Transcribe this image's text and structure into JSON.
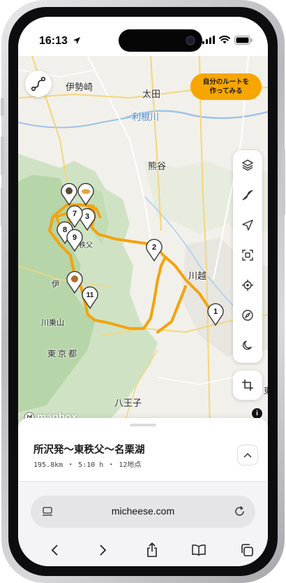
{
  "status": {
    "time": "16:13"
  },
  "map": {
    "labels": {
      "isesaki": "伊勢崎",
      "ota": "太田",
      "tonegawa": "利根川",
      "kumagaya": "熊谷",
      "kawagoe": "川越",
      "tokyo": "東京都",
      "hachioji": "八王子",
      "kawanoriyama": "川乗山",
      "chichibu_frag": "秩父",
      "ze": "伊",
      "edge_e": "東"
    },
    "cta": {
      "line1": "自分のルートを",
      "line2": "作ってみる"
    },
    "attribution": "mapbox",
    "info": "i",
    "pins": [
      "1",
      "2",
      "3",
      "7",
      "8",
      "9",
      "11"
    ]
  },
  "controls": [
    "layers-icon",
    "no-route-icon",
    "navigate-icon",
    "fit-icon",
    "locate-icon",
    "compass-icon",
    "dark-mode-icon"
  ],
  "colors": {
    "route": "#f3a30c",
    "accent": "#f7a600"
  },
  "route": {
    "title": "所沢発〜東秩父〜名栗湖",
    "meta": "195.8km ・ 5:10 h ・ 12地点"
  },
  "browser": {
    "url": "micheese.com"
  }
}
